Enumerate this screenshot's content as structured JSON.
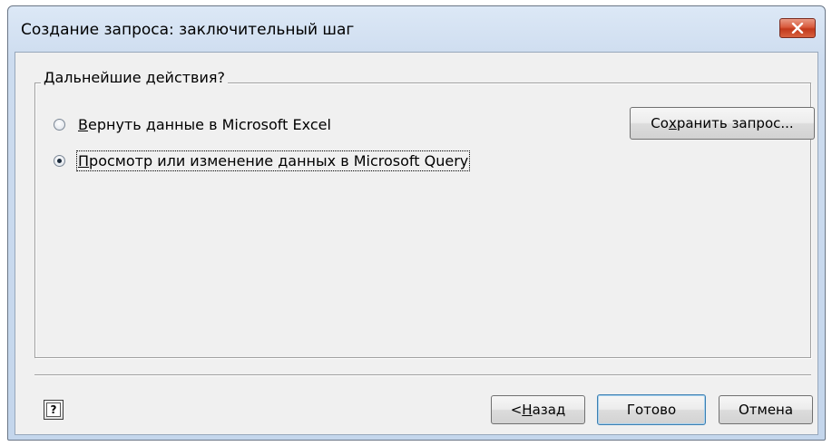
{
  "window": {
    "title": "Создание запроса: заключительный шаг",
    "close_icon": "close-x-icon"
  },
  "group": {
    "label": "Дальнейшие действия?"
  },
  "options": [
    {
      "prefix": "",
      "accel": "В",
      "rest": "ернуть данные в Microsoft Excel",
      "checked": false
    },
    {
      "prefix": "",
      "accel": "П",
      "rest": "росмотр или изменение данных в Microsoft Query",
      "checked": true
    }
  ],
  "buttons": {
    "save_query": {
      "prefix": "Со",
      "accel": "х",
      "rest": "ранить запрос..."
    },
    "back": {
      "prefix": "< ",
      "accel": "Н",
      "rest": "азад"
    },
    "finish": "Готово",
    "cancel": "Отмена",
    "help_icon": "help-question-icon",
    "help_glyph": "?"
  },
  "colors": {
    "title_bar": "#cddcef",
    "close_button": "#c2391b",
    "dialog_bg": "#f0f0f0",
    "default_button_border": "#3c7fb1"
  }
}
